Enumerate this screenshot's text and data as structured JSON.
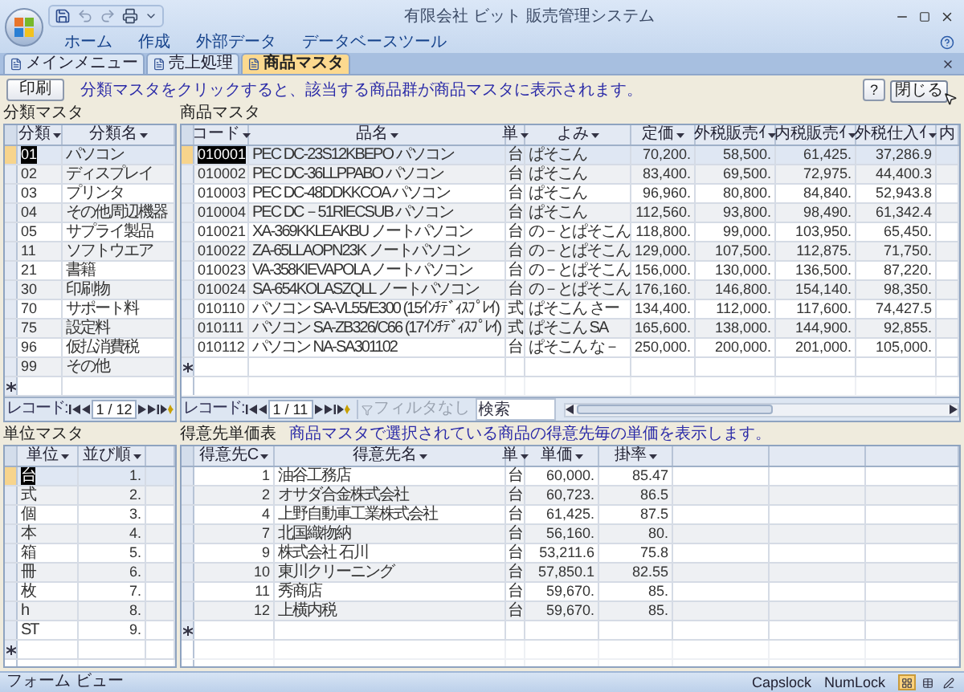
{
  "window": {
    "title": "有限会社 ビット 販売管理システム"
  },
  "ribbon_tabs": [
    "ホーム",
    "作成",
    "外部データ",
    "データベースツール"
  ],
  "document_tabs": [
    {
      "label": "メインメニュー",
      "selected": false
    },
    {
      "label": "売上処理",
      "selected": false
    },
    {
      "label": "商品マスタ",
      "selected": true
    }
  ],
  "toolbar": {
    "print_button": "印刷",
    "instruction": "分類マスタをクリックすると、該当する商品群が商品マスタに表示されます。",
    "help_button": "?",
    "close_button": "閉じる"
  },
  "category_master": {
    "title": "分類マスタ",
    "columns": [
      "分類",
      "分類名"
    ],
    "rows": [
      {
        "cells": [
          "01",
          "パソコン"
        ],
        "selected": true
      },
      {
        "cells": [
          "02",
          "ディスプレイ"
        ],
        "selected": false
      },
      {
        "cells": [
          "03",
          "プリンタ"
        ],
        "selected": false
      },
      {
        "cells": [
          "04",
          "その他周辺機器"
        ],
        "selected": false
      },
      {
        "cells": [
          "05",
          "サプライ製品"
        ],
        "selected": false
      },
      {
        "cells": [
          "11",
          "ソフトウエア"
        ],
        "selected": false
      },
      {
        "cells": [
          "21",
          "書籍"
        ],
        "selected": false
      },
      {
        "cells": [
          "30",
          "印刷物"
        ],
        "selected": false
      },
      {
        "cells": [
          "70",
          "サポート料"
        ],
        "selected": false
      },
      {
        "cells": [
          "75",
          "設定料"
        ],
        "selected": false
      },
      {
        "cells": [
          "96",
          "仮払消費税"
        ],
        "selected": false
      },
      {
        "cells": [
          "99",
          "その他"
        ],
        "selected": false
      }
    ],
    "navigator": {
      "label": "レコード:",
      "position": "1 / 12"
    }
  },
  "product_master": {
    "title": "商品マスタ",
    "columns": [
      "コード",
      "品名",
      "単",
      "よみ",
      "定価",
      "外税販売ｲ",
      "内税販売ｲ",
      "外税仕入ｲ",
      "内"
    ],
    "rows": [
      {
        "cells": [
          "010001",
          "PEC  DC-23S12KBEPO  パソコン",
          "台",
          "ぱそこん",
          "70,200.",
          "58,500.",
          "61,425.",
          "37,286.9"
        ],
        "selected": true
      },
      {
        "cells": [
          "010002",
          "PEC  DC-36LLPPABO  パソコン",
          "台",
          "ぱそこん",
          "83,400.",
          "69,500.",
          "72,975.",
          "44,400.3"
        ],
        "selected": false
      },
      {
        "cells": [
          "010003",
          "PEC  DC-48DDKKCOA  パソコン",
          "台",
          "ぱそこん",
          "96,960.",
          "80,800.",
          "84,840.",
          "52,943.8"
        ],
        "selected": false
      },
      {
        "cells": [
          "010004",
          "PEC  DC－51RIECSUB  パソコン",
          "台",
          "ぱそこん",
          "112,560.",
          "93,800.",
          "98,490.",
          "61,342.4"
        ],
        "selected": false
      },
      {
        "cells": [
          "010021",
          "XA-369KKLEAKBU  ノートパソコン",
          "台",
          "の－とぱそこん",
          "118,800.",
          "99,000.",
          "103,950.",
          "65,450."
        ],
        "selected": false
      },
      {
        "cells": [
          "010022",
          "ZA-65LLAOPN23K  ノートパソコン",
          "台",
          "の－とぱそこん",
          "129,000.",
          "107,500.",
          "112,875.",
          "71,750."
        ],
        "selected": false
      },
      {
        "cells": [
          "010023",
          "VA-358KIEVAPOLA  ノートパソコン",
          "台",
          "の－とぱそこん",
          "156,000.",
          "130,000.",
          "136,500.",
          "87,220."
        ],
        "selected": false
      },
      {
        "cells": [
          "010024",
          "SA-654KOLASZQLL  ノートパソコン",
          "台",
          "の－とぱそこん",
          "176,160.",
          "146,800.",
          "154,140.",
          "98,350."
        ],
        "selected": false
      },
      {
        "cells": [
          "010110",
          "パソコン  SA-VL55/E300 (15ｲﾝﾁﾃﾞｨｽﾌﾟﾚｲ)",
          "式",
          "ぱそこん さー",
          "134,400.",
          "112,000.",
          "117,600.",
          "74,427.5"
        ],
        "selected": false
      },
      {
        "cells": [
          "010111",
          "パソコン  SA-ZB326/C66 (17ｲﾝﾁﾃﾞｨｽﾌﾟﾚｲ)",
          "式",
          "ぱそこん SA",
          "165,600.",
          "138,000.",
          "144,900.",
          "92,855."
        ],
        "selected": false
      },
      {
        "cells": [
          "010112",
          "パソコン  NA-SA301102",
          "台",
          "ぱそこん な－",
          "250,000.",
          "200,000.",
          "201,000.",
          "105,000."
        ],
        "selected": false
      }
    ],
    "navigator": {
      "label": "レコード:",
      "position": "1 / 11",
      "filter": "フィルタなし",
      "search_placeholder": "検索"
    }
  },
  "unit_master": {
    "title": "単位マスタ",
    "columns": [
      "単位",
      "並び順"
    ],
    "rows": [
      {
        "cells": [
          "台",
          "1."
        ],
        "selected": true
      },
      {
        "cells": [
          "式",
          "2."
        ],
        "selected": false
      },
      {
        "cells": [
          "個",
          "3."
        ],
        "selected": false
      },
      {
        "cells": [
          "本",
          "4."
        ],
        "selected": false
      },
      {
        "cells": [
          "箱",
          "5."
        ],
        "selected": false
      },
      {
        "cells": [
          "冊",
          "6."
        ],
        "selected": false
      },
      {
        "cells": [
          "枚",
          "7."
        ],
        "selected": false
      },
      {
        "cells": [
          "h",
          "8."
        ],
        "selected": false
      },
      {
        "cells": [
          "ST",
          "9."
        ],
        "selected": false
      }
    ]
  },
  "customer_prices": {
    "title": "得意先単価表",
    "note": "商品マスタで選択されている商品の得意先毎の単価を表示します。",
    "columns": [
      "得意先C",
      "得意先名",
      "単",
      "単価",
      "掛率"
    ],
    "rows": [
      {
        "cells": [
          "1",
          "油谷工務店",
          "台",
          "60,000.",
          "85.47"
        ],
        "selected": false
      },
      {
        "cells": [
          "2",
          "オサダ合金株式会社",
          "台",
          "60,723.",
          "86.5"
        ],
        "selected": false
      },
      {
        "cells": [
          "4",
          "上野自動車工業株式会社",
          "台",
          "61,425.",
          "87.5"
        ],
        "selected": false
      },
      {
        "cells": [
          "7",
          "北国織物納",
          "台",
          "56,160.",
          "80."
        ],
        "selected": false
      },
      {
        "cells": [
          "9",
          "株式会社 石川",
          "台",
          "53,211.6",
          "75.8"
        ],
        "selected": false
      },
      {
        "cells": [
          "10",
          "東川クリーニング",
          "台",
          "57,850.1",
          "82.55"
        ],
        "selected": false
      },
      {
        "cells": [
          "11",
          "秀商店",
          "台",
          "59,670.",
          "85."
        ],
        "selected": false
      },
      {
        "cells": [
          "12",
          "上横内税",
          "台",
          "59,670.",
          "85."
        ],
        "selected": false
      }
    ]
  },
  "status_bar": {
    "view": "フォーム ビュー",
    "indicators": [
      "Capslock",
      "NumLock"
    ]
  }
}
